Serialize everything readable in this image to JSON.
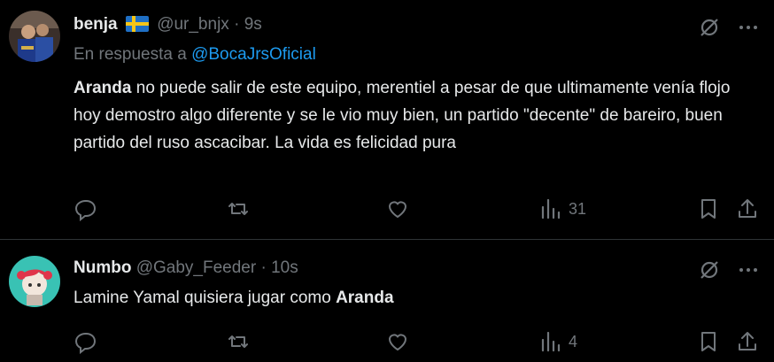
{
  "tweets": [
    {
      "author_name": "benja",
      "flag": "sweden-flag-icon",
      "handle": "@ur_bnjx",
      "dot": "·",
      "time": "9s",
      "reply_prefix": "En respuesta a",
      "reply_mention": "@BocaJrsOficial",
      "body_bold": "Aranda",
      "body_rest": " no puede salir de este equipo, merentiel a pesar de que ultimamente venía flojo hoy demostro algo diferente y se le vio muy bien, un partido \"decente\" de bareiro, buen partido del ruso ascacibar. La vida es felicidad pura",
      "views": "31"
    },
    {
      "author_name": "Numbo",
      "handle": "@Gaby_Feeder",
      "dot": "·",
      "time": "10s",
      "body_prefix": "Lamine Yamal quisiera jugar como ",
      "body_bold": "Aranda",
      "views": "4"
    }
  ],
  "colors": {
    "background": "#000000",
    "text": "#e7e9ea",
    "muted": "#71767b",
    "accent": "#1d9bf0",
    "divider": "#2f3336"
  }
}
